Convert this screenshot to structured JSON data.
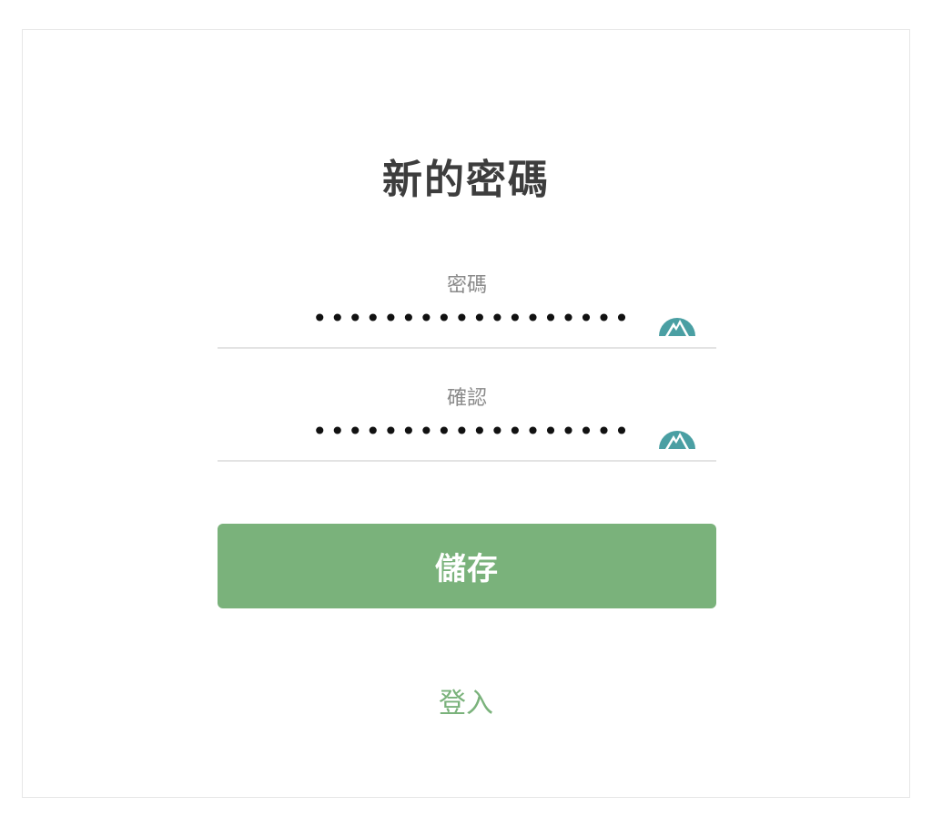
{
  "form": {
    "title": "新的密碼",
    "password": {
      "label": "密碼",
      "value": "••••••••••••••••••",
      "toggle_icon": "mountain-eye-icon"
    },
    "confirm": {
      "label": "確認",
      "value": "••••••••••••••••••",
      "toggle_icon": "mountain-eye-icon"
    },
    "save_label": "儲存",
    "login_link": "登入"
  },
  "colors": {
    "accent_green": "#7ab27b",
    "icon_teal": "#4a9fa3",
    "title_text": "#3d3d3d",
    "label_text": "#8a8a8a",
    "divider": "#e3e3e3",
    "card_border": "#e6e6e6"
  }
}
